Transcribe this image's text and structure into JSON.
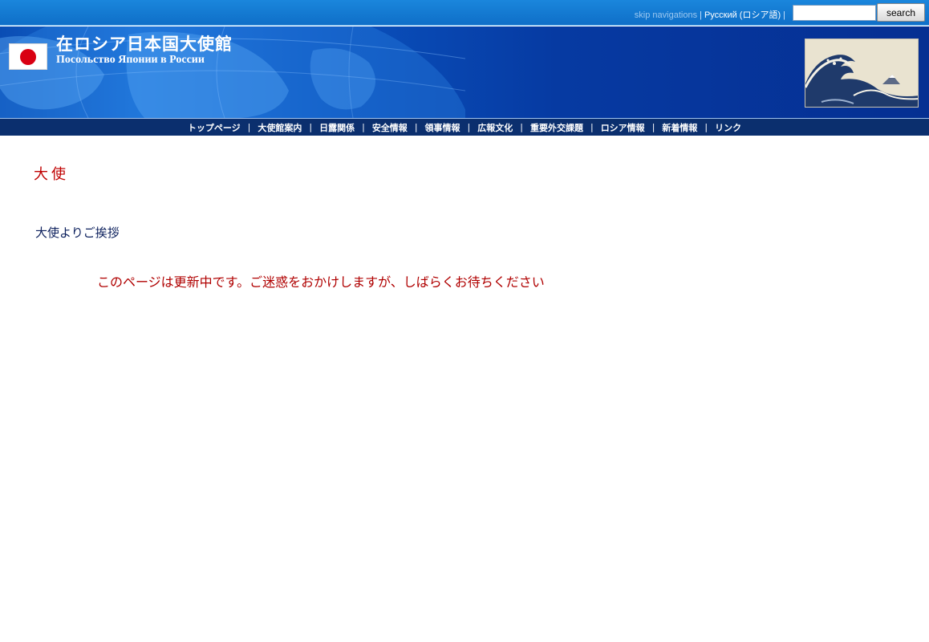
{
  "header": {
    "skip_link": "skip navigations",
    "separator": "|",
    "language_link": "Русский (ロシア語)",
    "search_placeholder": "",
    "search_button": "search",
    "title_jp": "在ロシア日本国大使館",
    "title_ru": "Посольство Японии в России"
  },
  "nav": {
    "items": [
      {
        "label": "トップページ"
      },
      {
        "label": "大使館案内"
      },
      {
        "label": "日露関係"
      },
      {
        "label": "安全情報"
      },
      {
        "label": "領事情報"
      },
      {
        "label": "広報文化"
      },
      {
        "label": "重要外交課題"
      },
      {
        "label": "ロシア情報"
      },
      {
        "label": "新着情報"
      },
      {
        "label": "リンク"
      }
    ]
  },
  "main": {
    "page_title": "大使",
    "section_heading": "大使よりご挨拶",
    "notice": "このページは更新中です。ご迷惑をおかけしますが、しばらくお待ちください"
  },
  "colors": {
    "topbar": "#1a86dc",
    "banner": "#0a52be",
    "navbar": "#0b2f6e",
    "title_red": "#c00000",
    "heading_navy": "#0b1f5c",
    "flag_red": "#d90012"
  },
  "icons": {
    "flag": "japan-flag-icon",
    "banner_image": "great-wave-image"
  }
}
